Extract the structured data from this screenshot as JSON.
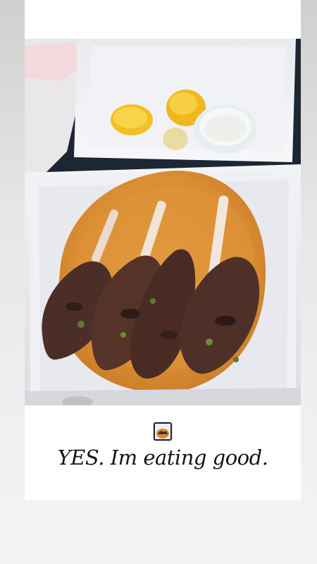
{
  "story": {
    "photo_subject": "meal-photo",
    "caption": "YES. Im eating good.",
    "thumbnail": "meal-thumbnail"
  },
  "colors": {
    "page_background": "#e9e9e9",
    "card_background": "#ffffff",
    "caption_text": "#151515"
  }
}
